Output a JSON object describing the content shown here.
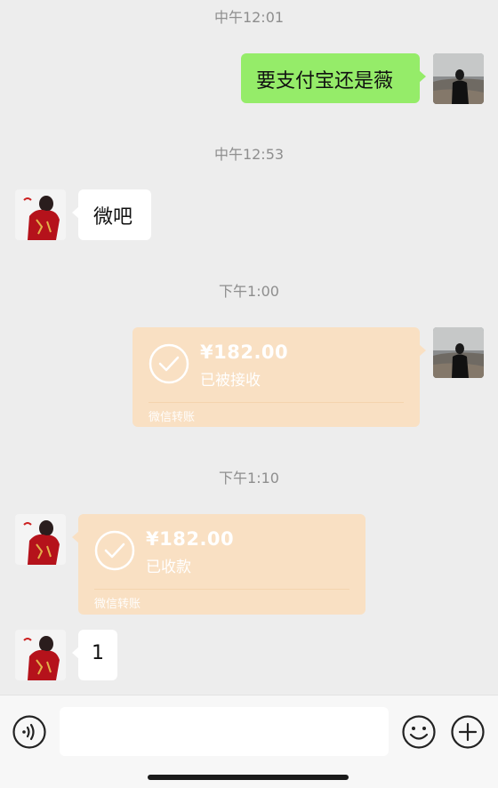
{
  "messages": {
    "t1": "中午12:01",
    "m1": "要支付宝还是薇",
    "t2": "中午12:53",
    "m2": "微吧",
    "t3": "下午1:00",
    "transfer1": {
      "amount": "¥182.00",
      "status": "已被接收",
      "label": "微信转账"
    },
    "t4": "下午1:10",
    "transfer2": {
      "amount": "¥182.00",
      "status": "已收款",
      "label": "微信转账"
    },
    "m3": "1"
  },
  "input_bar": {
    "value": "",
    "icons": [
      "voice-icon",
      "emoji-icon",
      "plus-icon"
    ]
  },
  "colors": {
    "sent_bubble": "#95ec69",
    "received_bubble": "#ffffff",
    "transfer_card": "#f9e0c3",
    "background": "#ededed"
  }
}
